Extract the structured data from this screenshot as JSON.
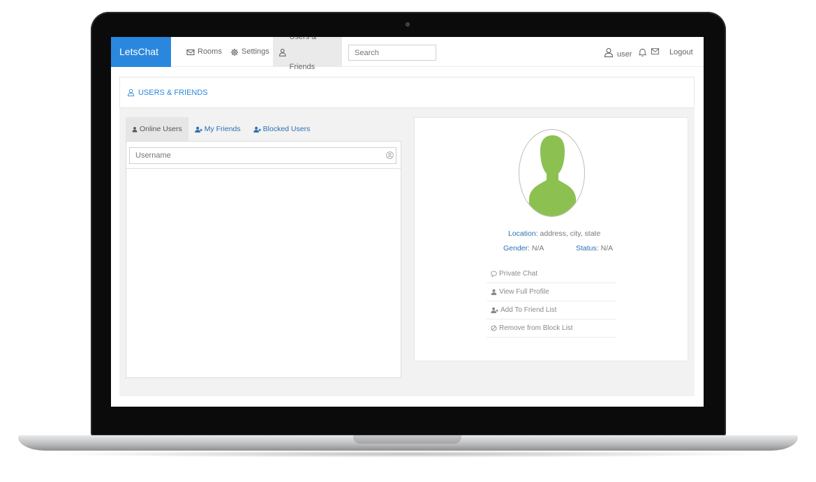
{
  "app": {
    "brand": "LetsChat"
  },
  "nav": {
    "rooms": "Rooms",
    "settings": "Settings",
    "users_friends": "Users & Friends"
  },
  "search": {
    "placeholder": "Search"
  },
  "user_menu": {
    "username": "user",
    "logout": "Logout"
  },
  "page": {
    "title": "USERS & FRIENDS"
  },
  "tabs": [
    {
      "label": "Online Users",
      "active": true
    },
    {
      "label": "My Friends",
      "active": false
    },
    {
      "label": "Blocked Users",
      "active": false
    }
  ],
  "user_search": {
    "placeholder": "Username"
  },
  "profile": {
    "location_label": "Location:",
    "location_value": " address, city, state",
    "gender_label": "Gender:",
    "gender_value": " N/A",
    "status_label": "Status:",
    "status_value": " N/A",
    "avatar_color": "#8cc152"
  },
  "actions": [
    {
      "label": "Private Chat",
      "icon": "comment-icon"
    },
    {
      "label": "View Full Profile",
      "icon": "user-icon"
    },
    {
      "label": "Add To Friend List",
      "icon": "user-plus-icon"
    },
    {
      "label": "Remove from Block List",
      "icon": "ban-icon"
    }
  ],
  "colors": {
    "accent": "#2b87dd",
    "link": "#2b70b5"
  }
}
